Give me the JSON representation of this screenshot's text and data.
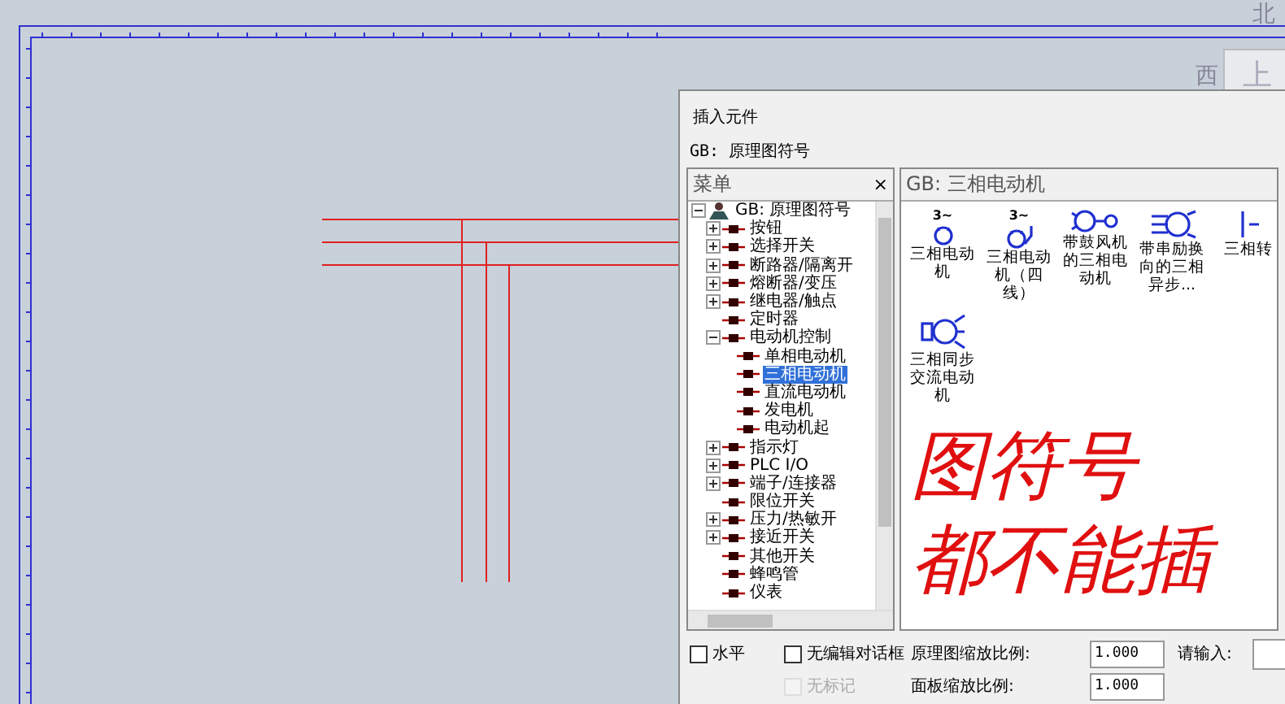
{
  "compass": {
    "north": "北",
    "west": "西",
    "panel_label": "上"
  },
  "dialog": {
    "title": "插入元件",
    "library": "GB: 原理图符号",
    "tree": {
      "title": "菜单",
      "close": "×",
      "items": [
        {
          "label": "GB: 原理图符号",
          "kind": "root",
          "expanded": true,
          "selected": false,
          "children": [
            {
              "label": "按钮",
              "expanded": false,
              "selected": false
            },
            {
              "label": "选择开关",
              "expanded": false,
              "selected": false
            },
            {
              "label": "断路器/隔离开",
              "expanded": false,
              "selected": false
            },
            {
              "label": "熔断器/变压",
              "expanded": false,
              "selected": false
            },
            {
              "label": "继电器/触点",
              "expanded": false,
              "selected": false
            },
            {
              "label": "定时器",
              "selected": false
            },
            {
              "label": "电动机控制",
              "expanded": true,
              "selected": false,
              "children": [
                {
                  "label": "单相电动机",
                  "selected": false
                },
                {
                  "label": "三相电动机",
                  "selected": true
                },
                {
                  "label": "直流电动机",
                  "selected": false
                },
                {
                  "label": "发电机",
                  "selected": false
                },
                {
                  "label": "电动机起",
                  "selected": false
                }
              ]
            },
            {
              "label": "指示灯",
              "expanded": false,
              "selected": false
            },
            {
              "label": "PLC I/O",
              "expanded": false,
              "selected": false
            },
            {
              "label": "端子/连接器",
              "expanded": false,
              "selected": false
            },
            {
              "label": "限位开关",
              "selected": false
            },
            {
              "label": "压力/热敏开",
              "expanded": false,
              "selected": false
            },
            {
              "label": "接近开关",
              "expanded": false,
              "selected": false
            },
            {
              "label": "其他开关",
              "selected": false
            },
            {
              "label": "蜂鸣管",
              "selected": false
            },
            {
              "label": "仪表",
              "selected": false
            }
          ]
        }
      ]
    },
    "gallery": {
      "title": "GB: 三相电动机",
      "items": [
        {
          "kind": "motor",
          "badge": "3~",
          "label": "三相电动机"
        },
        {
          "kind": "motor4",
          "badge": "3~",
          "label": "三相电动机（四线）"
        },
        {
          "kind": "fan",
          "label": "带鼓风机的三相电动机"
        },
        {
          "kind": "brake",
          "label": "带串励换向的三相异步..."
        },
        {
          "kind": "partial",
          "label": "三相转"
        },
        {
          "kind": "sync",
          "label": "三相同步交流电动机"
        }
      ]
    },
    "annotation": [
      "图符号",
      "都不能插"
    ],
    "options": [
      {
        "label": "水平",
        "checked": false,
        "disabled": false
      },
      {
        "label": "无编辑对话框",
        "checked": false,
        "disabled": false
      },
      {
        "label": "无标记",
        "checked": false,
        "disabled": true
      }
    ],
    "scales": [
      {
        "label": "原理图缩放比例:",
        "value": "1.000"
      },
      {
        "label": "面板缩放比例:",
        "value": "1.000"
      }
    ],
    "input": {
      "label": "请输入:"
    }
  }
}
